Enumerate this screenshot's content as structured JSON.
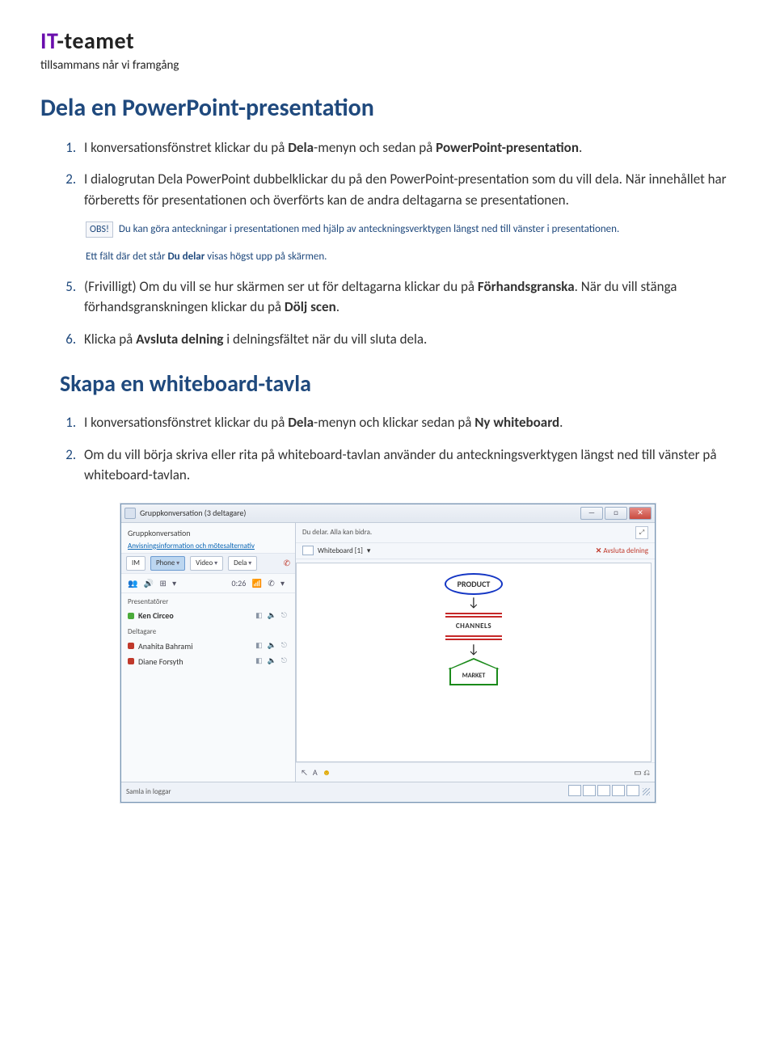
{
  "logo": {
    "it": "IT",
    "teamet": "-teamet",
    "tagline": "tillsammans når vi framgång"
  },
  "h1": "Dela en PowerPoint-presentation",
  "list1": {
    "i1_a": "I konversationsfönstret klickar du på ",
    "i1_b": "Dela",
    "i1_c": "-menyn och sedan på ",
    "i1_d": "PowerPoint-presentation",
    "i1_e": ".",
    "i2_a": "I dialogrutan Dela PowerPoint dubbelklickar du på den PowerPoint-presentation som du vill dela. När innehållet har förberetts för presentationen och överförts kan de andra deltagarna se presentationen."
  },
  "note_obs": "OBS!",
  "note_text": "Du kan göra anteckningar i presentationen med hjälp av anteckningsverktygen längst ned till vänster i presentationen.",
  "subnote_a": "Ett fält där det står ",
  "subnote_b": "Du delar",
  "subnote_c": " visas högst upp på skärmen.",
  "list2": {
    "i5_a": "(Frivilligt) Om du vill se hur skärmen ser ut för deltagarna klickar du på ",
    "i5_b": "Förhandsgranska",
    "i5_c": ". När du vill stänga förhandsgranskningen klickar du på ",
    "i5_d": "Dölj scen",
    "i5_e": ".",
    "i6_a": "Klicka på ",
    "i6_b": "Avsluta delning",
    "i6_c": " i delningsfältet när du vill sluta dela."
  },
  "h2": "Skapa en whiteboard-tavla",
  "list3": {
    "i1_a": "I konversationsfönstret klickar du på ",
    "i1_b": "Dela",
    "i1_c": "-menyn och klickar sedan på ",
    "i1_d": "Ny whiteboard",
    "i1_e": ".",
    "i2": "Om du vill börja skriva eller rita på whiteboard-tavlan använder du anteckningsverktygen längst ned till vänster på whiteboard-tavlan."
  },
  "app": {
    "title": "Gruppkonversation (3 deltagare)",
    "win_min": "—",
    "win_max": "□",
    "win_close": "✕",
    "conv_title": "Gruppkonversation",
    "conv_link": "Anvisningsinformation och mötesalternativ",
    "im": "IM",
    "phone": "Phone",
    "video": "Video",
    "dela": "Dela",
    "timer": "0:26",
    "presenters_label": "Presentatörer",
    "participants_label": "Deltagare",
    "p1": "Ken Circeo",
    "p2": "Anahita Bahrami",
    "p3": "Diane Forsyth",
    "share_msg": "Du delar. Alla kan bidra.",
    "wb_name": "Whiteboard [1]",
    "stop_share": "Avsluta delning",
    "wb_product": "PRODUCT",
    "wb_channels": "CHANNELS",
    "wb_market": "MARKET",
    "footer_a": "A",
    "bottom_label": "Samla in loggar"
  }
}
